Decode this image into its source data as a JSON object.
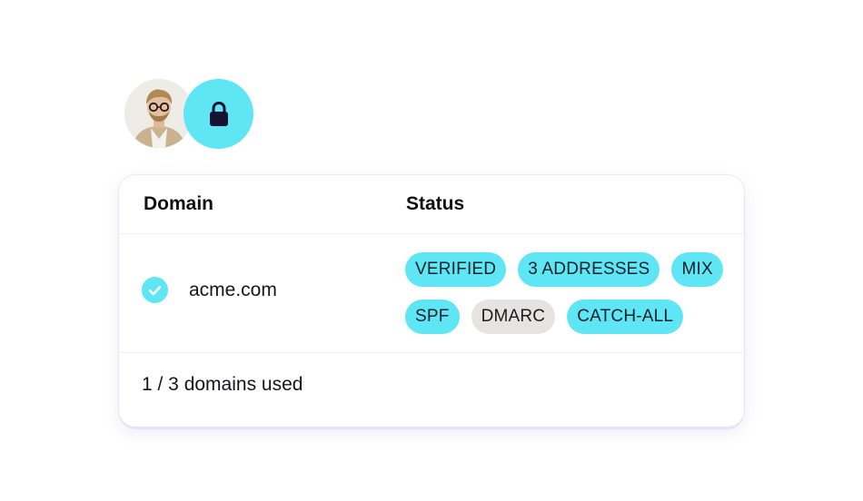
{
  "avatars": {
    "user_photo": "user-avatar",
    "lock_icon": "lock-icon"
  },
  "colors": {
    "accent": "#5ee6f5",
    "neutral_tag": "#e6e4e1",
    "text": "#111118"
  },
  "table": {
    "headers": {
      "domain": "Domain",
      "status": "Status"
    },
    "rows": [
      {
        "domain": "acme.com",
        "verified_icon": "check-circle-icon",
        "tags": [
          {
            "label": "VERIFIED",
            "style": "accent"
          },
          {
            "label": "3 ADDRESSES",
            "style": "accent"
          },
          {
            "label": "MIX",
            "style": "accent"
          },
          {
            "label": "SPF",
            "style": "accent"
          },
          {
            "label": "DMARC",
            "style": "neutral"
          },
          {
            "label": "CATCH-ALL",
            "style": "accent"
          }
        ]
      }
    ],
    "footer": "1 / 3 domains used"
  }
}
